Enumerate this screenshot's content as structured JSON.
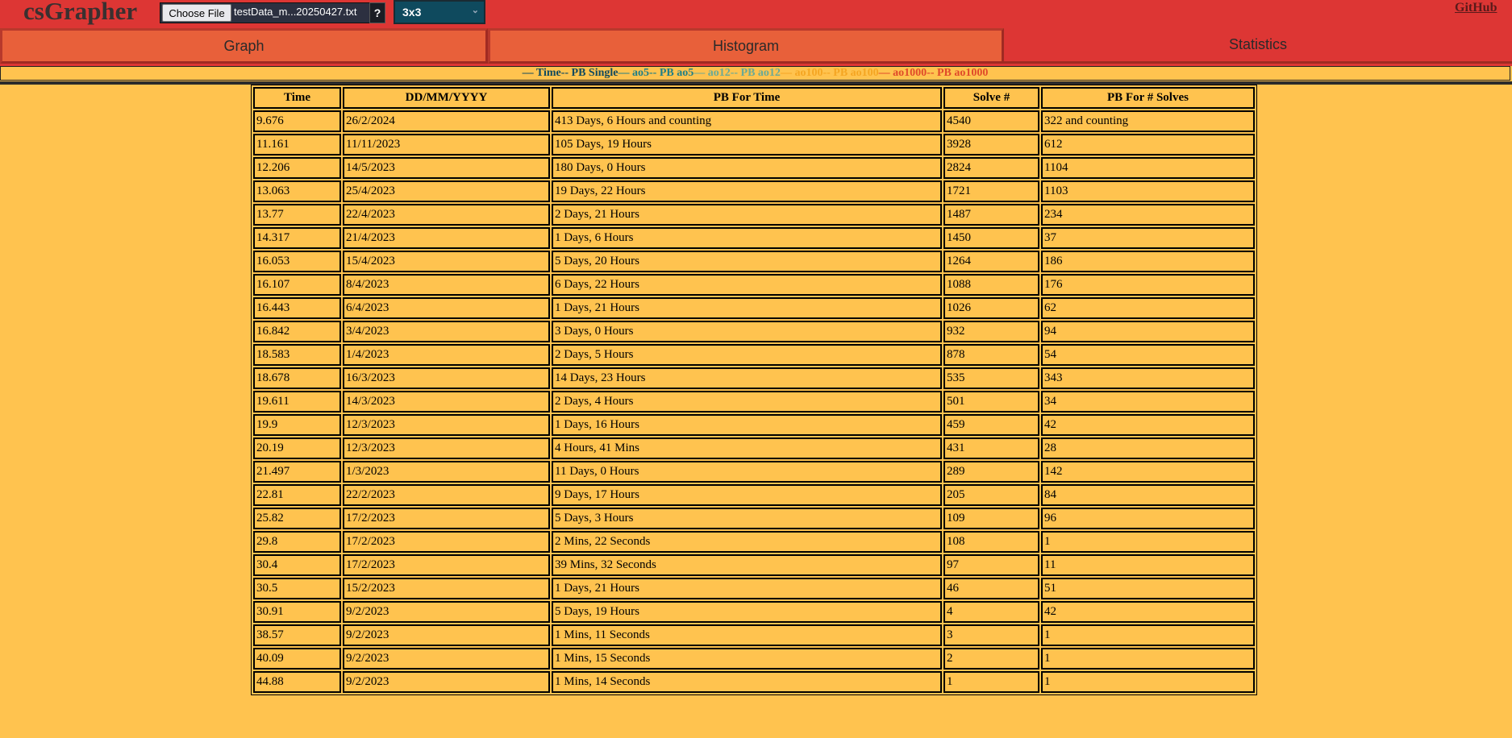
{
  "app": {
    "title": "csGrapher",
    "github_label": "GitHub"
  },
  "file": {
    "button_label": "Choose File",
    "file_name": "testData_m...20250427.txt",
    "help_label": "?"
  },
  "puzzle_select": {
    "value": "3x3"
  },
  "tabs": [
    {
      "label": "Graph",
      "active": false
    },
    {
      "label": "Histogram",
      "active": false
    },
    {
      "label": "Statistics",
      "active": true
    }
  ],
  "legend": [
    {
      "label": "— Time",
      "color": "#0f4a5e"
    },
    {
      "label": "-- PB Single",
      "color": "#0f4a5e"
    },
    {
      "label": "— ao5",
      "color": "#1f7f87"
    },
    {
      "label": "-- PB ao5",
      "color": "#1f7f87"
    },
    {
      "label": "— ao12",
      "color": "#6aaa96"
    },
    {
      "label": "-- PB ao12",
      "color": "#6aaa96"
    },
    {
      "label": "— ao100",
      "color": "#f5a623"
    },
    {
      "label": "-- PB ao100",
      "color": "#f5a623"
    },
    {
      "label": "— ao1000",
      "color": "#e04a2a"
    },
    {
      "label": "-- PB ao1000",
      "color": "#e04a2a"
    }
  ],
  "table": {
    "headers": [
      "Time",
      "DD/MM/YYYY",
      "PB For Time",
      "Solve #",
      "PB For # Solves"
    ],
    "rows": [
      [
        "9.676",
        "26/2/2024",
        "413 Days, 6 Hours and counting",
        "4540",
        "322 and counting"
      ],
      [
        "11.161",
        "11/11/2023",
        "105 Days, 19 Hours",
        "3928",
        "612"
      ],
      [
        "12.206",
        "14/5/2023",
        "180 Days, 0 Hours",
        "2824",
        "1104"
      ],
      [
        "13.063",
        "25/4/2023",
        "19 Days, 22 Hours",
        "1721",
        "1103"
      ],
      [
        "13.77",
        "22/4/2023",
        "2 Days, 21 Hours",
        "1487",
        "234"
      ],
      [
        "14.317",
        "21/4/2023",
        "1 Days, 6 Hours",
        "1450",
        "37"
      ],
      [
        "16.053",
        "15/4/2023",
        "5 Days, 20 Hours",
        "1264",
        "186"
      ],
      [
        "16.107",
        "8/4/2023",
        "6 Days, 22 Hours",
        "1088",
        "176"
      ],
      [
        "16.443",
        "6/4/2023",
        "1 Days, 21 Hours",
        "1026",
        "62"
      ],
      [
        "16.842",
        "3/4/2023",
        "3 Days, 0 Hours",
        "932",
        "94"
      ],
      [
        "18.583",
        "1/4/2023",
        "2 Days, 5 Hours",
        "878",
        "54"
      ],
      [
        "18.678",
        "16/3/2023",
        "14 Days, 23 Hours",
        "535",
        "343"
      ],
      [
        "19.611",
        "14/3/2023",
        "2 Days, 4 Hours",
        "501",
        "34"
      ],
      [
        "19.9",
        "12/3/2023",
        "1 Days, 16 Hours",
        "459",
        "42"
      ],
      [
        "20.19",
        "12/3/2023",
        "4 Hours, 41 Mins",
        "431",
        "28"
      ],
      [
        "21.497",
        "1/3/2023",
        "11 Days, 0 Hours",
        "289",
        "142"
      ],
      [
        "22.81",
        "22/2/2023",
        "9 Days, 17 Hours",
        "205",
        "84"
      ],
      [
        "25.82",
        "17/2/2023",
        "5 Days, 3 Hours",
        "109",
        "96"
      ],
      [
        "29.8",
        "17/2/2023",
        "2 Mins, 22 Seconds",
        "108",
        "1"
      ],
      [
        "30.4",
        "17/2/2023",
        "39 Mins, 32 Seconds",
        "97",
        "11"
      ],
      [
        "30.5",
        "15/2/2023",
        "1 Days, 21 Hours",
        "46",
        "51"
      ],
      [
        "30.91",
        "9/2/2023",
        "5 Days, 19 Hours",
        "4",
        "42"
      ],
      [
        "38.57",
        "9/2/2023",
        "1 Mins, 11 Seconds",
        "3",
        "1"
      ],
      [
        "40.09",
        "9/2/2023",
        "1 Mins, 15 Seconds",
        "2",
        "1"
      ],
      [
        "44.88",
        "9/2/2023",
        "1 Mins, 14 Seconds",
        "1",
        "1"
      ]
    ]
  }
}
